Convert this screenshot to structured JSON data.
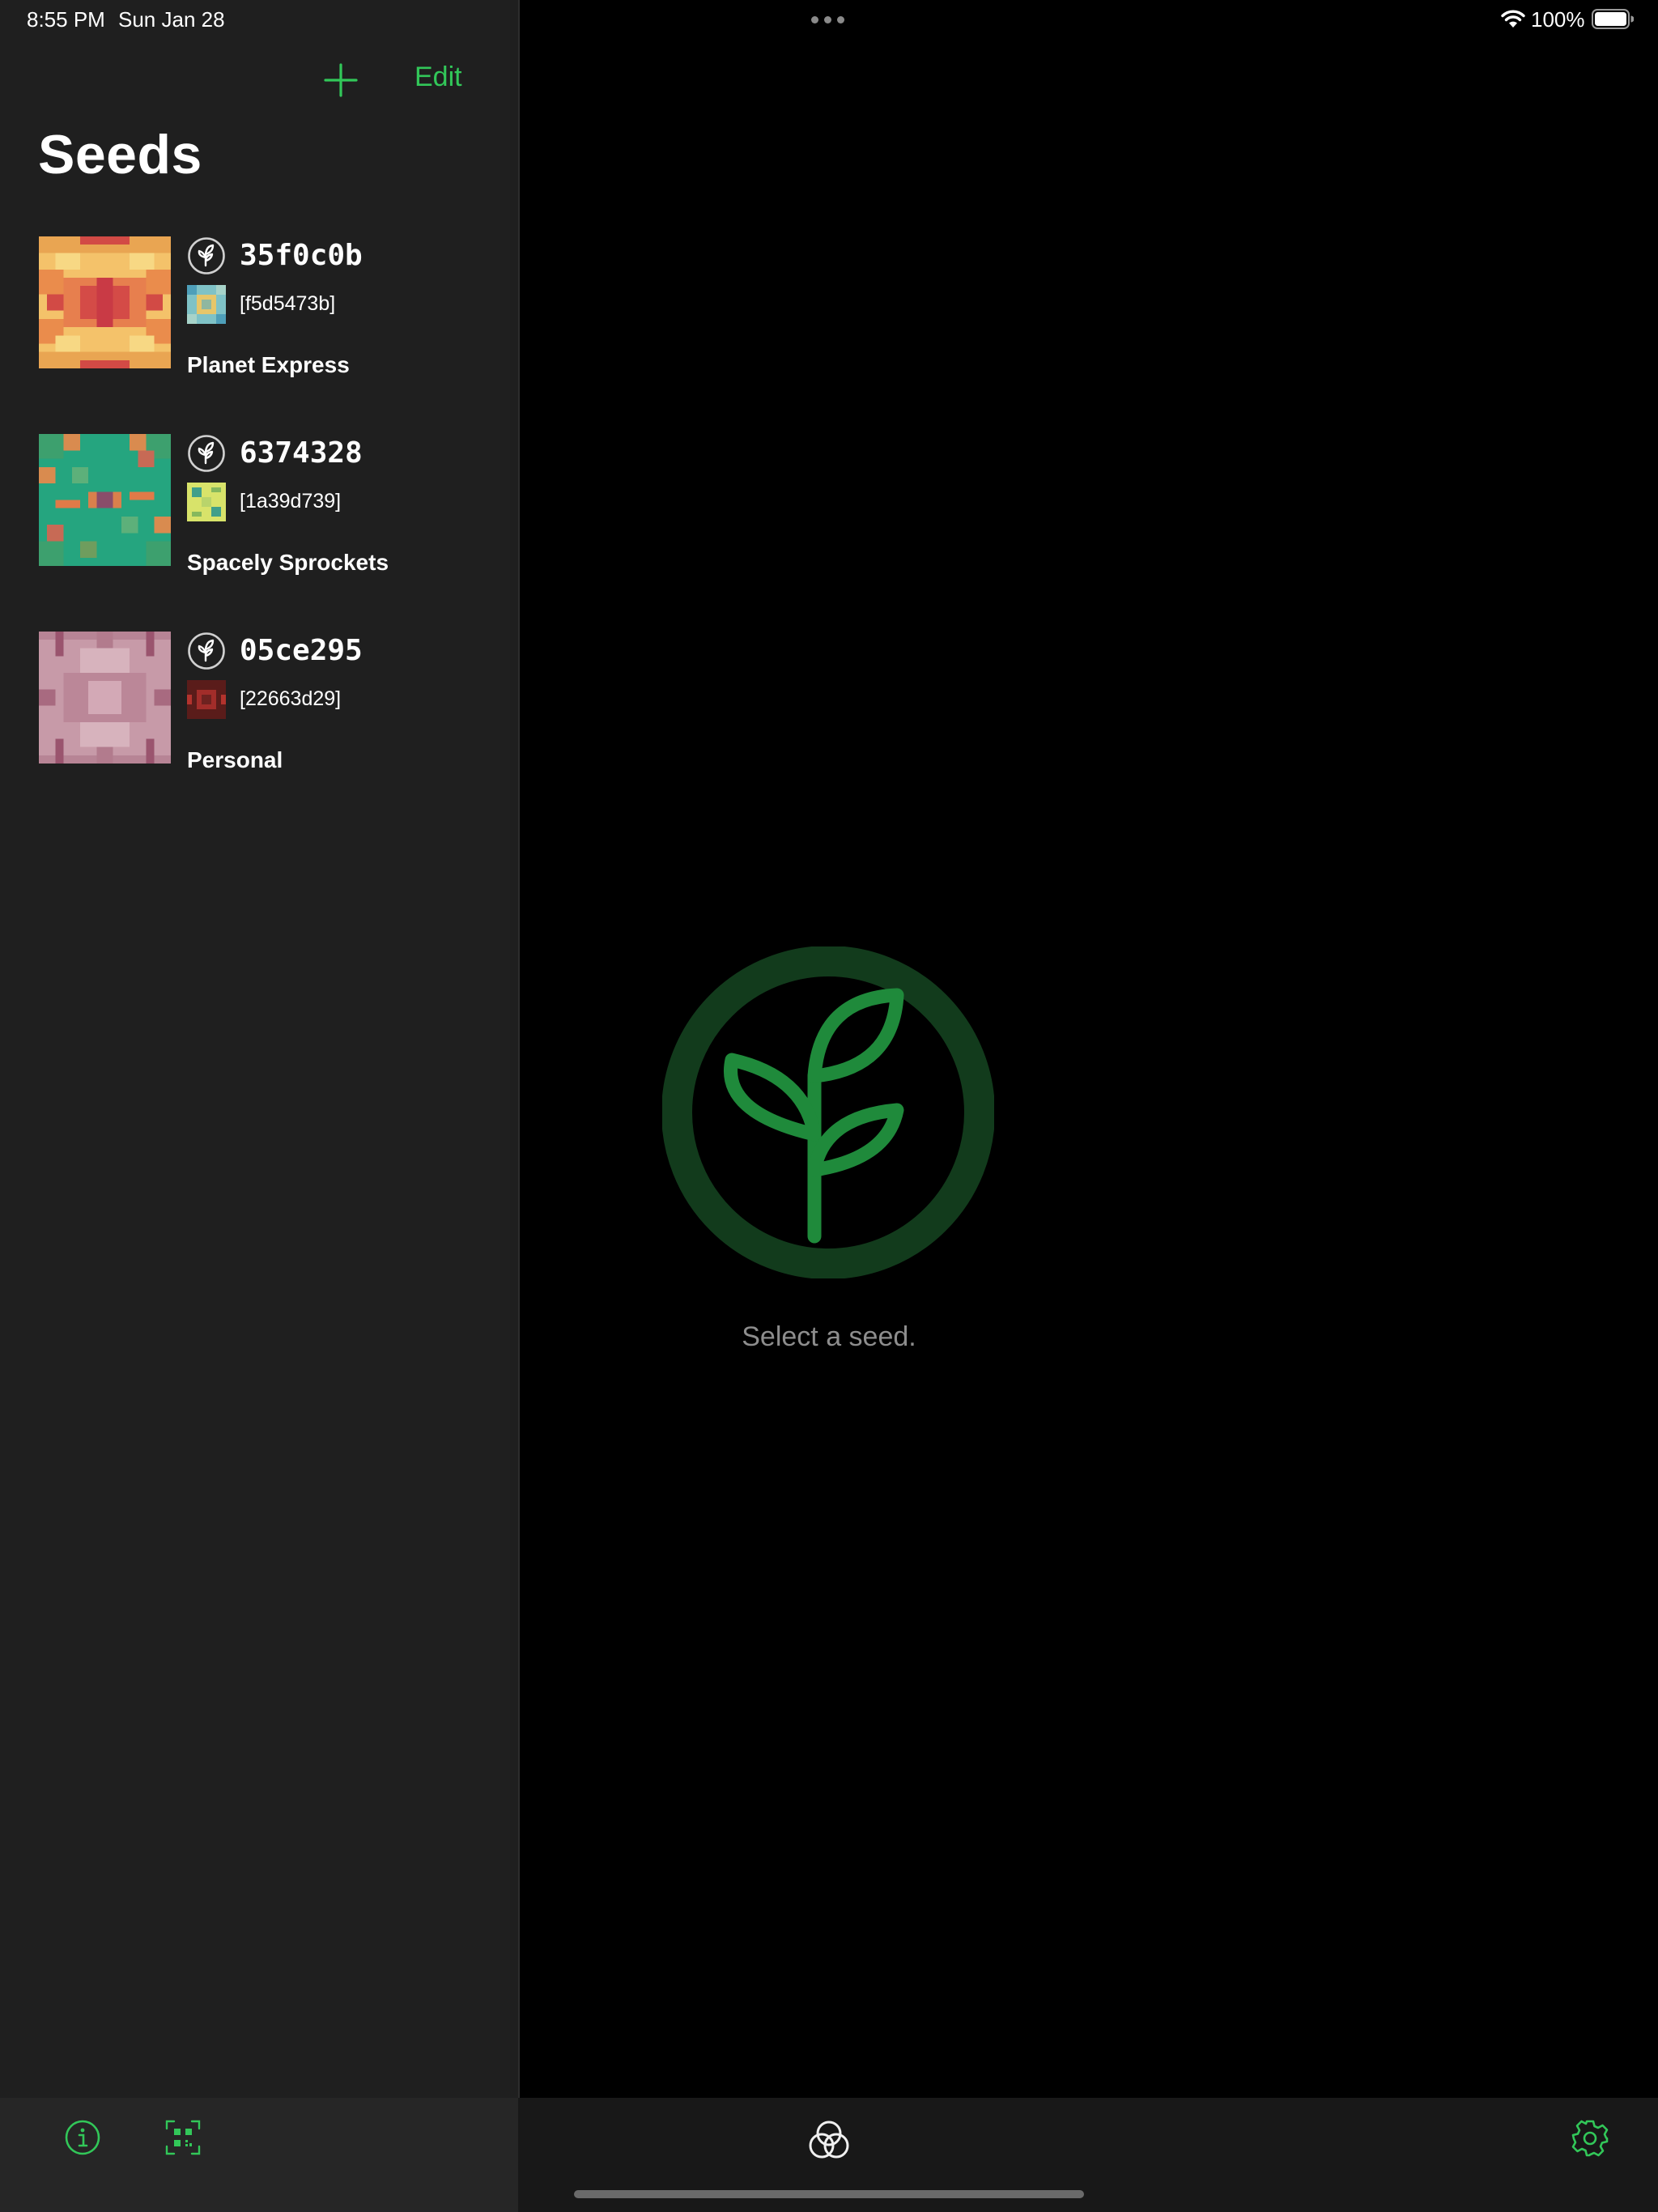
{
  "status_bar": {
    "time": "8:55 PM",
    "date": "Sun Jan 28",
    "battery_percent": "100%"
  },
  "sidebar": {
    "edit_label": "Edit",
    "title": "Seeds",
    "seeds": [
      {
        "id": "35f0c0b",
        "key_id": "[f5d5473b]",
        "name": "Planet Express"
      },
      {
        "id": "6374328",
        "key_id": "[1a39d739]",
        "name": "Spacely Sprockets"
      },
      {
        "id": "05ce295",
        "key_id": "[22663d29]",
        "name": "Personal"
      }
    ]
  },
  "detail": {
    "placeholder": "Select a seed."
  },
  "colors": {
    "accent": "#32c759",
    "sidebar_bg": "#1f1f1f",
    "detail_bg": "#000000"
  },
  "icons": {
    "add": "plus-icon",
    "info": "info-icon",
    "scan": "qr-scan-icon",
    "center": "blockchain-commons-icon",
    "settings": "gear-icon",
    "seed": "seedling-icon"
  }
}
